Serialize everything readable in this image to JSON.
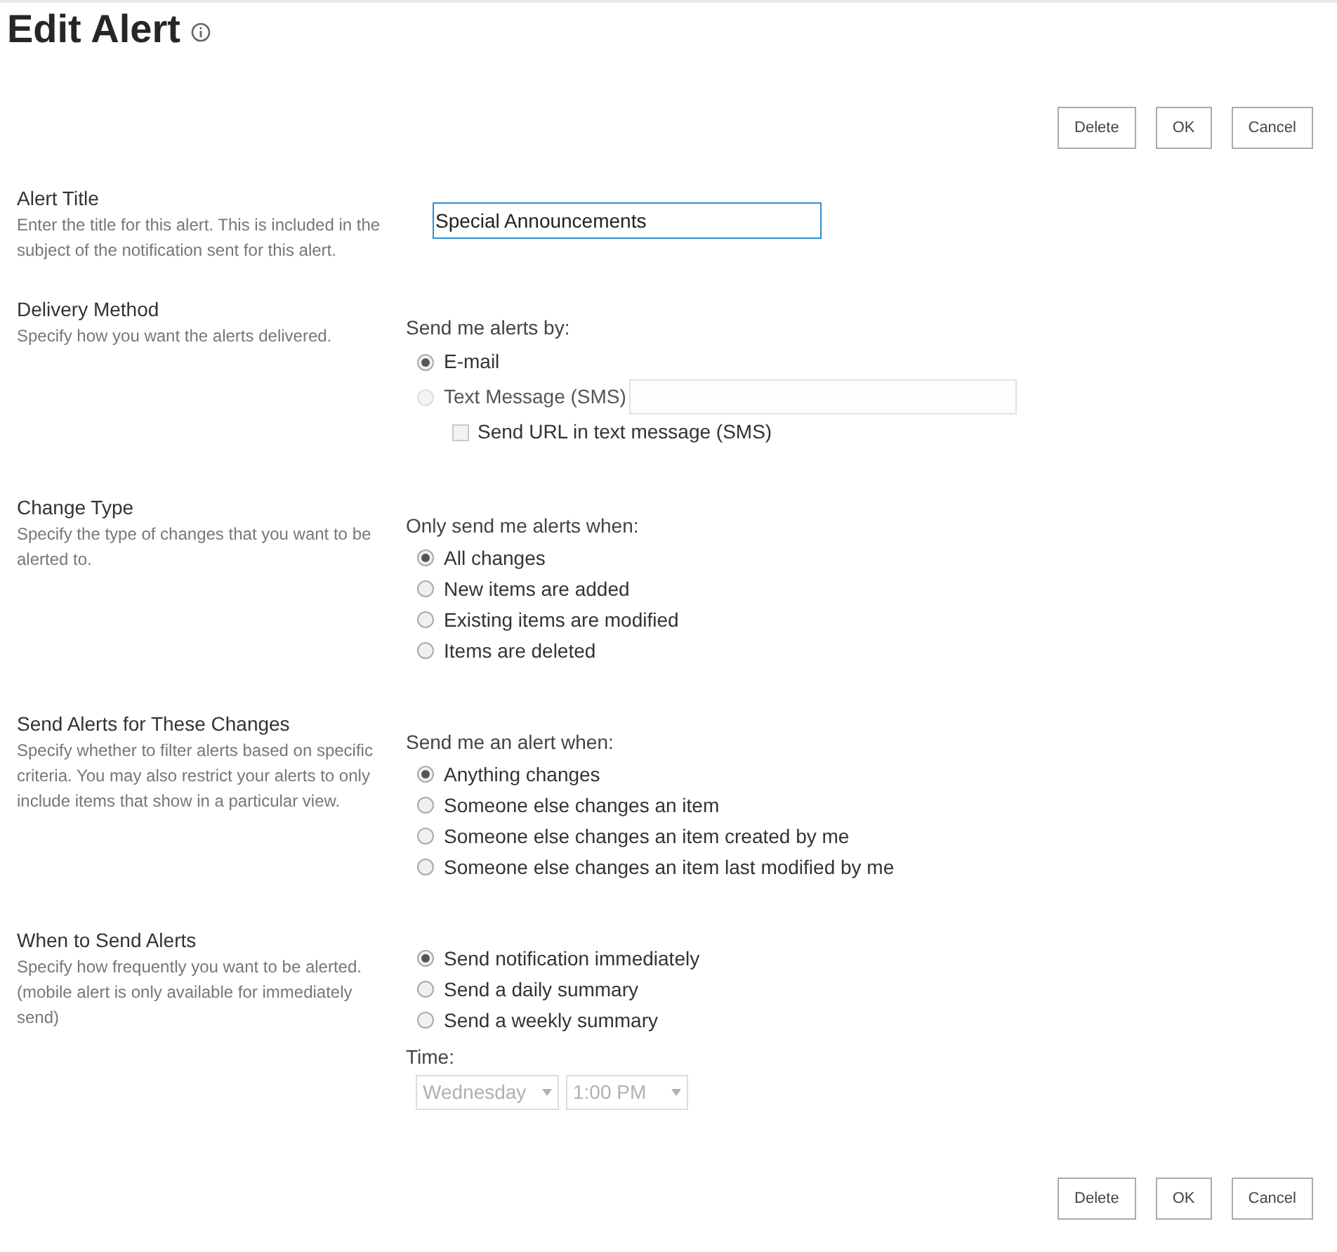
{
  "page": {
    "title": "Edit Alert"
  },
  "top_buttons": [
    "Delete",
    "OK",
    "Cancel"
  ],
  "sections": [
    {
      "title": "Alert Title",
      "description": "Enter the title for this alert. This is included in the subject of the notification sent for this alert.",
      "kind": "text",
      "value": "Special Announcements"
    },
    {
      "title": "Delivery Method",
      "description": "Specify how you want the alerts delivered.",
      "kind": "choices",
      "prompt": "Send me alerts by:",
      "options": [
        {
          "kind": "radio",
          "label": "E-mail",
          "selected": true,
          "disabled": false
        },
        {
          "kind": "radio_field",
          "label": "Text Message (SMS)",
          "selected": false,
          "disabled": true
        },
        {
          "kind": "checkbox",
          "label": "Send URL in text message (SMS)",
          "checked": false
        }
      ]
    },
    {
      "title": "Change Type",
      "description": "Specify the type of changes that you want to be alerted to.",
      "kind": "choices",
      "prompt": "Only send me alerts when:",
      "options": [
        {
          "kind": "radio",
          "label": "All changes",
          "selected": true,
          "disabled": false
        },
        {
          "kind": "radio",
          "label": "New items are added",
          "selected": false,
          "disabled": false
        },
        {
          "kind": "radio",
          "label": "Existing items are modified",
          "selected": false,
          "disabled": false
        },
        {
          "kind": "radio",
          "label": "Items are deleted",
          "selected": false,
          "disabled": false
        }
      ]
    },
    {
      "title": "Send Alerts for These Changes",
      "description": "Specify whether to filter alerts based on specific criteria. You may also restrict your alerts to only include items that show in a particular view.",
      "kind": "choices",
      "prompt": "Send me an alert when:",
      "options": [
        {
          "kind": "radio",
          "label": "Anything changes",
          "selected": true,
          "disabled": false
        },
        {
          "kind": "radio",
          "label": "Someone else changes an item",
          "selected": false,
          "disabled": false
        },
        {
          "kind": "radio",
          "label": "Someone else changes an item created by me",
          "selected": false,
          "disabled": false
        },
        {
          "kind": "radio",
          "label": "Someone else changes an item last modified by me",
          "selected": false,
          "disabled": false
        }
      ]
    },
    {
      "title": "When to Send Alerts",
      "description": "Specify how frequently you want to be alerted. (mobile alert is only available for immediately send)",
      "kind": "choices",
      "options": [
        {
          "kind": "radio",
          "label": "Send notification immediately",
          "selected": true,
          "disabled": false
        },
        {
          "kind": "radio",
          "label": "Send a daily summary",
          "selected": false,
          "disabled": false
        },
        {
          "kind": "radio",
          "label": "Send a weekly summary",
          "selected": false,
          "disabled": false
        }
      ],
      "time": {
        "label": "Time:",
        "day": "Wednesday",
        "hour": "1:00 PM",
        "disabled": true
      }
    }
  ],
  "bottom_buttons": [
    "Delete",
    "OK",
    "Cancel"
  ]
}
